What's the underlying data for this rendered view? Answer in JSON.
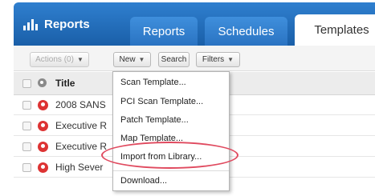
{
  "header": {
    "brand_label": "Reports",
    "tabs": [
      {
        "label": "Reports"
      },
      {
        "label": "Schedules"
      },
      {
        "label": "Templates"
      }
    ]
  },
  "toolbar": {
    "actions_label": "Actions (0)",
    "new_label": "New",
    "search_label": "Search",
    "filters_label": "Filters"
  },
  "table": {
    "columns": [
      "Title"
    ],
    "rows": [
      {
        "title": "2008 SANS"
      },
      {
        "title": "Executive R"
      },
      {
        "title": "Executive R"
      },
      {
        "title": "High Sever"
      }
    ]
  },
  "menu": {
    "items": [
      "Scan Template...",
      "PCI Scan Template...",
      "Patch Template...",
      "Map Template...",
      "Import from Library...",
      "Download..."
    ],
    "highlighted_item": "Import from Library...",
    "highlight_color": "#e04a5f"
  },
  "colors": {
    "header_blue": "#1a5fa8",
    "tab_blue": "#3f8fdc",
    "status_red": "#dd3333"
  }
}
